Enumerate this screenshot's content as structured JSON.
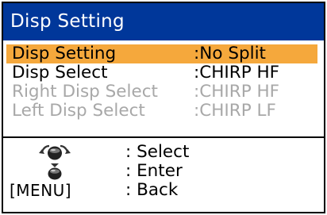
{
  "window": {
    "title": "Disp Setting"
  },
  "menu": {
    "items": [
      {
        "label": "Disp Setting",
        "value": ":No Split",
        "state": "selected"
      },
      {
        "label": "Disp Select",
        "value": ":CHIRP HF",
        "state": "normal"
      },
      {
        "label": "Right Disp Select",
        "value": ":CHIRP HF",
        "state": "disabled"
      },
      {
        "label": "Left Disp Select",
        "value": ":CHIRP LF",
        "state": "disabled"
      }
    ]
  },
  "help": {
    "rows": [
      {
        "key_icon": "rotary-knob-icon",
        "desc": ": Select"
      },
      {
        "key_icon": "knob-press-icon",
        "desc": ": Enter"
      },
      {
        "key_label": "[MENU]",
        "desc": ": Back"
      }
    ]
  },
  "colors": {
    "title_bg": "#00379a",
    "title_fg": "#ffffff",
    "highlight": "#f5a83c",
    "disabled_text": "#a8a8a8"
  }
}
